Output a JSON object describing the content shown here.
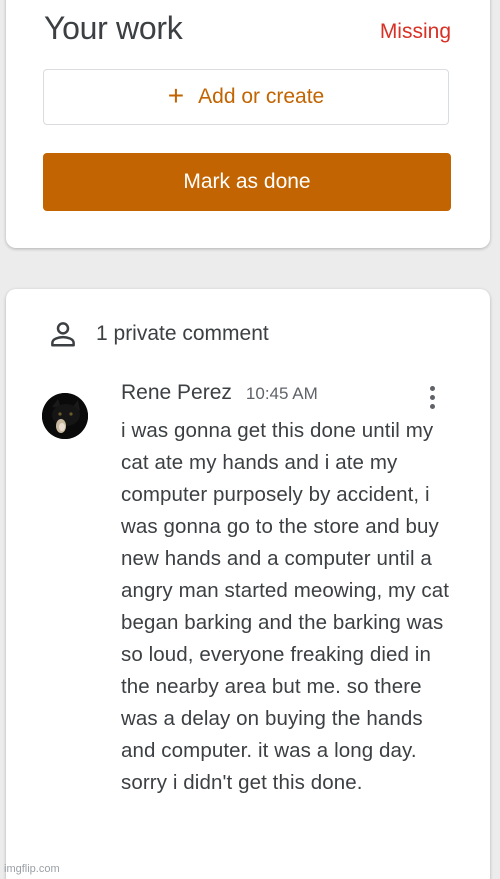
{
  "work": {
    "title": "Your work",
    "status": "Missing",
    "add_label": "Add or create",
    "done_label": "Mark as done",
    "accent": "#c26401",
    "status_color": "#d93025"
  },
  "comments": {
    "header": "1 private comment",
    "items": [
      {
        "author": "Rene Perez",
        "time": "10:45 AM",
        "text": "i was gonna get this done until my cat ate my hands and i ate my computer purposely by accident, i was gonna go to the store and buy new hands and a computer until a angry man started meowing, my cat began barking and the barking was so loud, everyone freaking died in the nearby area but me. so there was a delay on buying the hands and computer. it was a long day. sorry i didn't get this done."
      }
    ]
  },
  "watermark": "imgflip.com",
  "icons": {
    "add": "plus-icon",
    "comments": "person-icon",
    "menu": "more-vertical-icon"
  }
}
